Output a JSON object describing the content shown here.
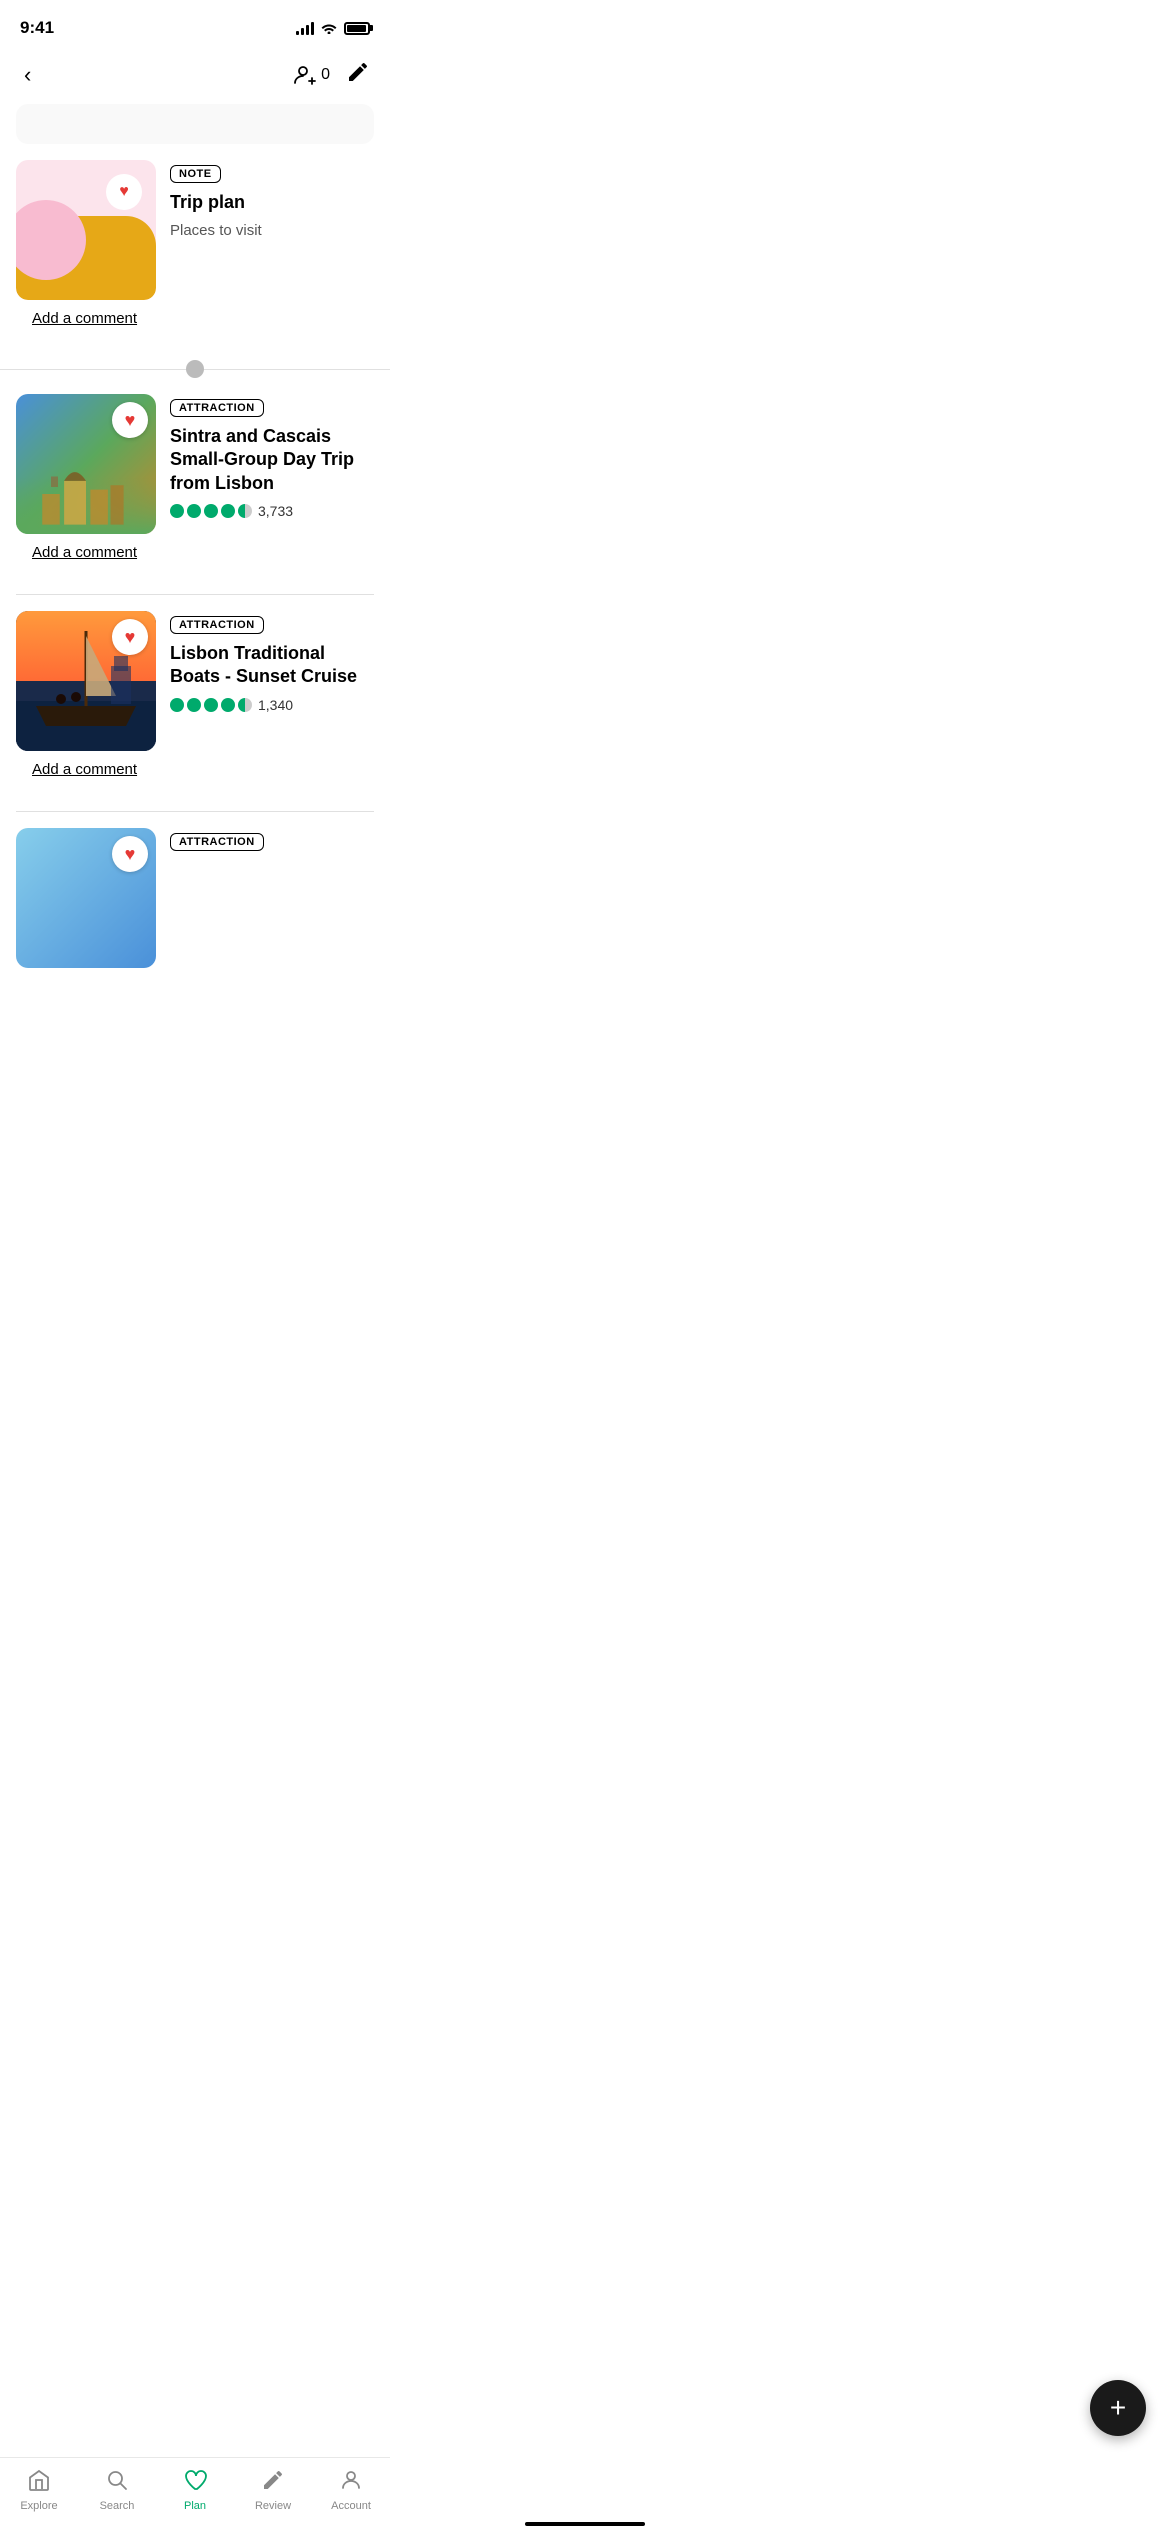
{
  "statusBar": {
    "time": "9:41"
  },
  "header": {
    "backLabel": "<",
    "memberCount": "0",
    "editLabel": "✎"
  },
  "items": [
    {
      "id": "note-trip-plan",
      "type": "NOTE",
      "title": "Trip plan",
      "subtitle": "Places to visit",
      "addComment": "Add a comment",
      "isNote": true
    },
    {
      "id": "sintra-cascais",
      "type": "ATTRACTION",
      "title": "Sintra and Cascais Small-Group Day Trip from Lisbon",
      "rating": 4.5,
      "reviewCount": "3,733",
      "addComment": "Add a comment"
    },
    {
      "id": "lisbon-boats",
      "type": "ATTRACTION",
      "title": "Lisbon Traditional Boats - Sunset Cruise",
      "rating": 4.5,
      "reviewCount": "1,340",
      "addComment": "Add a comment"
    },
    {
      "id": "partial-item",
      "type": "ATTRACTION",
      "title": "",
      "isPartial": true
    }
  ],
  "fab": {
    "label": "+"
  },
  "bottomNav": [
    {
      "id": "explore",
      "label": "Explore",
      "icon": "house",
      "active": false
    },
    {
      "id": "search",
      "label": "Search",
      "icon": "search",
      "active": false
    },
    {
      "id": "plan",
      "label": "Plan",
      "icon": "heart-outline",
      "active": true
    },
    {
      "id": "review",
      "label": "Review",
      "icon": "pencil",
      "active": false
    },
    {
      "id": "account",
      "label": "Account",
      "icon": "person",
      "active": false
    }
  ]
}
